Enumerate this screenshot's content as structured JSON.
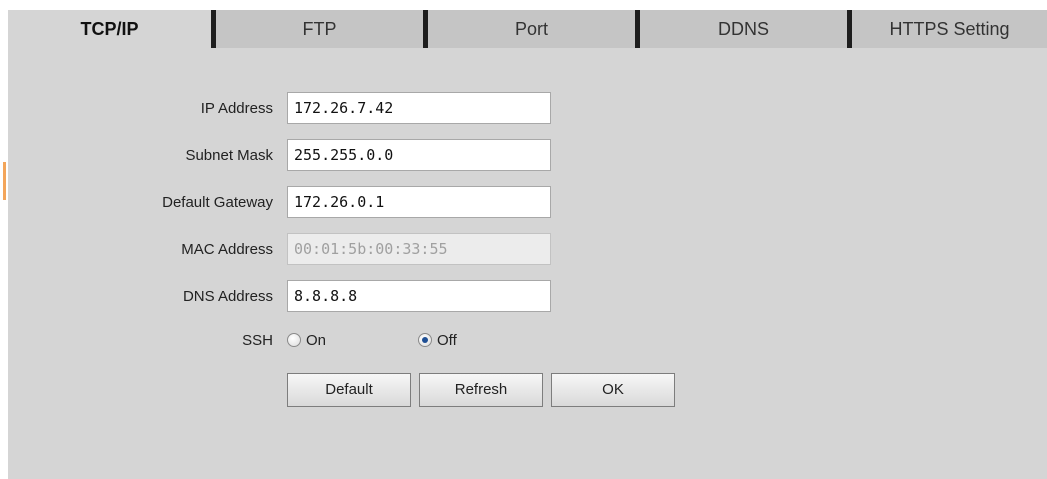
{
  "tabs": [
    {
      "label": "TCP/IP",
      "active": true
    },
    {
      "label": "FTP",
      "active": false
    },
    {
      "label": "Port",
      "active": false
    },
    {
      "label": "DDNS",
      "active": false
    },
    {
      "label": "HTTPS Setting",
      "active": false
    }
  ],
  "form": {
    "ip_address": {
      "label": "IP Address",
      "value": "172.26.7.42"
    },
    "subnet_mask": {
      "label": "Subnet Mask",
      "value": "255.255.0.0"
    },
    "default_gateway": {
      "label": "Default Gateway",
      "value": "172.26.0.1"
    },
    "mac_address": {
      "label": "MAC Address",
      "value": "00:01:5b:00:33:55",
      "disabled": true
    },
    "dns_address": {
      "label": "DNS Address",
      "value": "8.8.8.8"
    },
    "ssh": {
      "label": "SSH",
      "options": [
        {
          "label": "On",
          "checked": false
        },
        {
          "label": "Off",
          "checked": true
        }
      ]
    }
  },
  "buttons": {
    "default_label": "Default",
    "refresh_label": "Refresh",
    "ok_label": "OK"
  },
  "colors": {
    "panel_bg": "#d5d5d5",
    "tab_separator": "#1e1e1e",
    "accent_left": "#f3a55a",
    "radio_selected": "#1f4f94"
  }
}
